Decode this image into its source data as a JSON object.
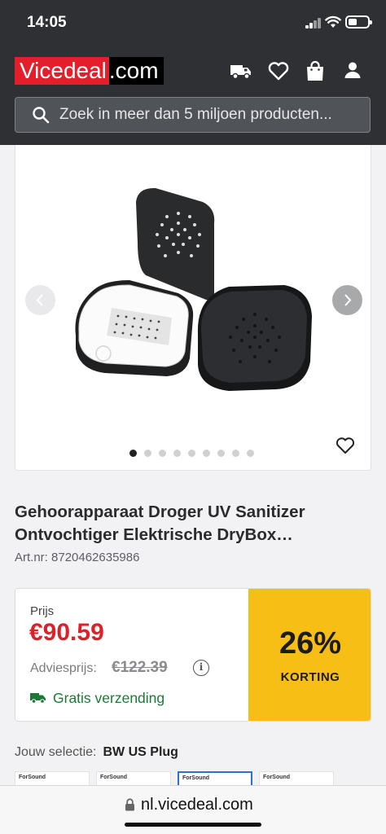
{
  "status": {
    "time": "14:05"
  },
  "header": {
    "logo_part1": "Vicedeal",
    "logo_part2": ".com",
    "icons": [
      "truck-icon",
      "heart-icon",
      "shopping-bag-icon",
      "user-icon"
    ]
  },
  "search": {
    "placeholder": "Zoek in meer dan 5 miljoen producten..."
  },
  "gallery": {
    "image_count": 9,
    "active_index": 0
  },
  "product": {
    "title": "Gehoorapparaat Droger UV Sanitizer Ontvochtiger Elektrische DryBox…",
    "art_nr": "Art.nr: 8720462635986"
  },
  "price": {
    "label": "Prijs",
    "current": "€90.59",
    "advies_label": "Adviesprijs:",
    "old": "€122.39",
    "info_icon": "i",
    "shipping": "Gratis verzending",
    "discount_pct": "26%",
    "discount_label": "KORTING"
  },
  "selection": {
    "label": "Jouw selectie:",
    "value": "BW US Plug"
  },
  "variants": [
    "ForSound",
    "ForSound",
    "ForSound",
    "ForSound"
  ],
  "browser": {
    "url": "nl.vicedeal.com"
  },
  "colors": {
    "brand_red": "#e41f2b",
    "price_red": "#d8232a",
    "discount_yellow": "#f7bf15",
    "shipping_green": "#1a7a35"
  }
}
